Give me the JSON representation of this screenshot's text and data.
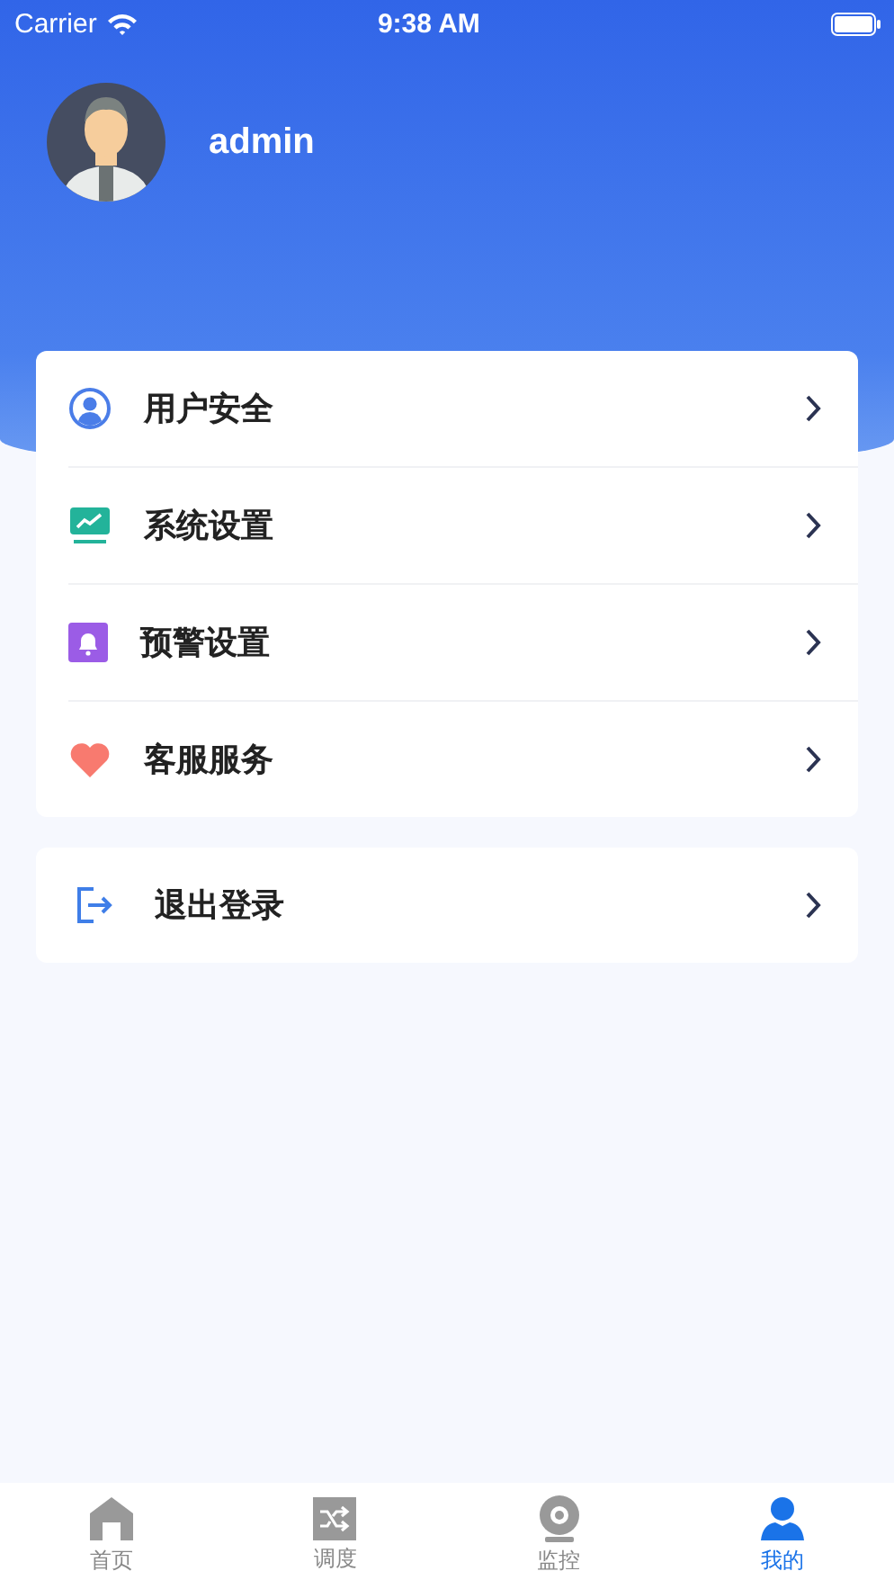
{
  "status_bar": {
    "carrier": "Carrier",
    "time": "9:38 AM"
  },
  "profile": {
    "name": "admin"
  },
  "menu": [
    {
      "label": "用户安全"
    },
    {
      "label": "系统设置"
    },
    {
      "label": "预警设置"
    },
    {
      "label": "客服服务"
    }
  ],
  "logout": {
    "label": "退出登录"
  },
  "tabs": [
    {
      "label": "首页",
      "selected": false
    },
    {
      "label": "调度",
      "selected": false
    },
    {
      "label": "监控",
      "selected": false
    },
    {
      "label": "我的",
      "selected": true
    }
  ]
}
